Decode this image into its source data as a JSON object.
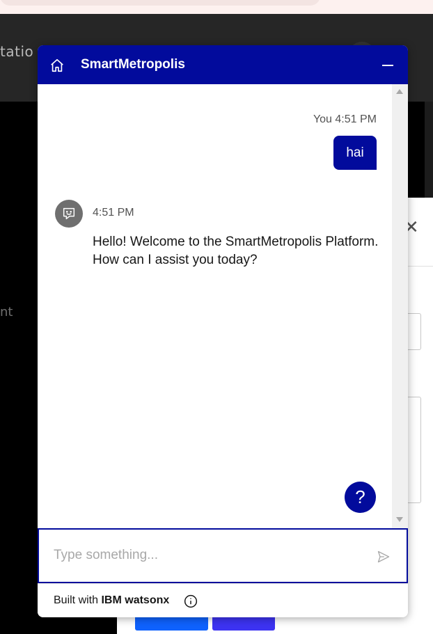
{
  "background": {
    "nav_text": "tatio",
    "side_text": "nt",
    "modal_close": "✕"
  },
  "chat": {
    "title": "SmartMetropolis",
    "messages": {
      "user": {
        "sender": "You",
        "time": "4:51 PM",
        "text": "hai"
      },
      "bot": {
        "time": "4:51 PM",
        "text": "Hello! Welcome to the SmartMetropolis Platform. How can I assist you today?"
      }
    },
    "help_label": "?",
    "input": {
      "placeholder": "Type something...",
      "value": ""
    },
    "footer": {
      "prefix": "Built with ",
      "brand": "IBM watsonx"
    }
  },
  "colors": {
    "accent": "#020b9c",
    "avatar": "#6f6f6f"
  },
  "icons": [
    "home-icon",
    "minimize-icon",
    "bot-avatar-icon",
    "help-icon",
    "send-icon",
    "info-icon",
    "close-icon"
  ]
}
